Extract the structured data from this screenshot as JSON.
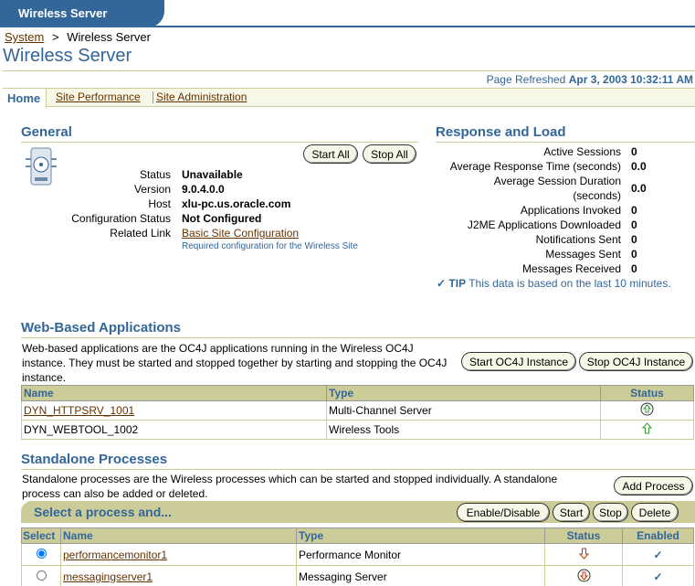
{
  "app": {
    "tab_title": "Wireless Server"
  },
  "breadcrumb": {
    "root": "System",
    "sep": ">",
    "current": "Wireless Server"
  },
  "page": {
    "title": "Wireless Server",
    "refreshed_label": "Page Refreshed",
    "refreshed_value": "Apr 3, 2003 10:32:11 AM"
  },
  "tabs": [
    {
      "label": "Home",
      "active": true
    },
    {
      "label": "Site Performance",
      "active": false
    },
    {
      "label": "Site Administration",
      "active": false
    }
  ],
  "general": {
    "title": "General",
    "start_all": "Start All",
    "stop_all": "Stop All",
    "rows": [
      {
        "label": "Status",
        "value": "Unavailable"
      },
      {
        "label": "Version",
        "value": "9.0.4.0.0"
      },
      {
        "label": "Host",
        "value": "xlu-pc.us.oracle.com"
      },
      {
        "label": "Configuration Status",
        "value": "Not Configured"
      },
      {
        "label": "Related Link",
        "value": "Basic Site Configuration"
      }
    ],
    "related_note": "Required configuration for the Wireless Site"
  },
  "response": {
    "title": "Response and Load",
    "rows": [
      {
        "label": "Active Sessions",
        "value": "0"
      },
      {
        "label": "Average Response Time (seconds)",
        "value": "0.0"
      },
      {
        "label": "Average Session Duration",
        "label2": "(seconds)",
        "value": "0.0"
      },
      {
        "label": "Applications Invoked",
        "value": "0"
      },
      {
        "label": "J2ME Applications Downloaded",
        "value": "0"
      },
      {
        "label": "Notifications Sent",
        "value": "0"
      },
      {
        "label": "Messages Sent",
        "value": "0"
      },
      {
        "label": "Messages Received",
        "value": "0"
      }
    ],
    "tip_label": "TIP",
    "tip_text": "This data is based on the last 10 minutes."
  },
  "web_apps": {
    "title": "Web-Based Applications",
    "desc": "Web-based applications are the OC4J applications running in the Wireless OC4J instance. They must be started and stopped together by starting and stopping the OC4J instance.",
    "start_btn": "Start OC4J Instance",
    "stop_btn": "Stop OC4J Instance",
    "columns": [
      "Name",
      "Type",
      "Status"
    ],
    "rows": [
      {
        "name": "DYN_HTTPSRV_1001",
        "type": "Multi-Channel Server",
        "link": true
      },
      {
        "name": "DYN_WEBTOOL_1002",
        "type": "Wireless Tools",
        "link": false
      }
    ]
  },
  "standalone": {
    "title": "Standalone Processes",
    "desc": "Standalone processes are the Wireless processes which can be started and stopped individually. A standalone process can also be added or deleted.",
    "add_btn": "Add Process",
    "select_label": "Select a process and...",
    "actions": [
      "Enable/Disable",
      "Start",
      "Stop",
      "Delete"
    ],
    "columns": [
      "Select",
      "Name",
      "Type",
      "Status",
      "Enabled"
    ],
    "rows": [
      {
        "name": "performancemonitor1",
        "type": "Performance Monitor"
      },
      {
        "name": "messagingserver1",
        "type": "Messaging Server"
      }
    ]
  },
  "colors": {
    "accent": "#336699",
    "link": "#663300",
    "tan": "#cccc99"
  }
}
